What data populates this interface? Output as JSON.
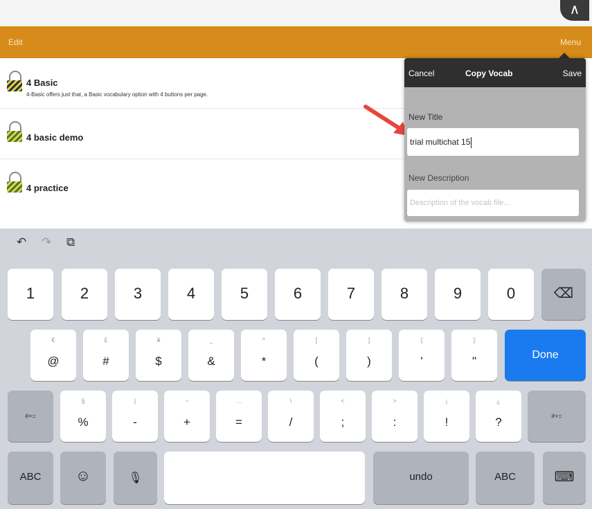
{
  "window": {
    "corner_label": "∧"
  },
  "topbar": {
    "edit_label": "Edit",
    "menu_label": "Menu"
  },
  "vocab_list": [
    {
      "title": "4 Basic",
      "description": "4-Basic offers just that, a Basic vocabulary option with 4 buttons per page.",
      "lock_icon": "lock-icon"
    },
    {
      "title": "4 basic demo",
      "description": "",
      "lock_icon": "lock-icon"
    },
    {
      "title": "4 practice",
      "description": "",
      "lock_icon": "lock-icon"
    }
  ],
  "copy_popover": {
    "cancel_label": "Cancel",
    "title": "Copy Vocab",
    "save_label": "Save",
    "new_title_label": "New Title",
    "new_title_value": "trial multichat 15",
    "new_description_label": "New Description",
    "new_description_placeholder": "Description of the vocab file..."
  },
  "keyboard": {
    "toolbar": {
      "undo_icon": "↶",
      "redo_icon": "↷",
      "paste_icon": "⧉"
    },
    "row1": [
      "1",
      "2",
      "3",
      "4",
      "5",
      "6",
      "7",
      "8",
      "9",
      "0"
    ],
    "row2": [
      {
        "main": "@",
        "alt": "€"
      },
      {
        "main": "#",
        "alt": "£"
      },
      {
        "main": "$",
        "alt": "¥"
      },
      {
        "main": "&",
        "alt": "_"
      },
      {
        "main": "*",
        "alt": "^"
      },
      {
        "main": "(",
        "alt": "["
      },
      {
        "main": ")",
        "alt": "]"
      },
      {
        "main": "'",
        "alt": "{"
      },
      {
        "main": "\"",
        "alt": "}"
      }
    ],
    "row3": [
      {
        "main": "%",
        "alt": "§"
      },
      {
        "main": "-",
        "alt": "|"
      },
      {
        "main": "+",
        "alt": "~"
      },
      {
        "main": "=",
        "alt": "…"
      },
      {
        "main": "/",
        "alt": "\\"
      },
      {
        "main": ";",
        "alt": "<"
      },
      {
        "main": ":",
        "alt": ">"
      },
      {
        "main": "!",
        "alt": "¡"
      },
      {
        "main": "?",
        "alt": "¿"
      }
    ],
    "done_label": "Done",
    "symbols_label": "#+=",
    "abc_label": "ABC",
    "undo_label": "undo",
    "backspace_icon": "⌫",
    "emoji_icon": "☺",
    "mic_icon": "🎙",
    "hide_keyboard_icon": "⌨"
  },
  "colors": {
    "accent_orange": "#d78b1a",
    "done_blue": "#1a7bf0",
    "arrow_red": "#e8453c"
  }
}
